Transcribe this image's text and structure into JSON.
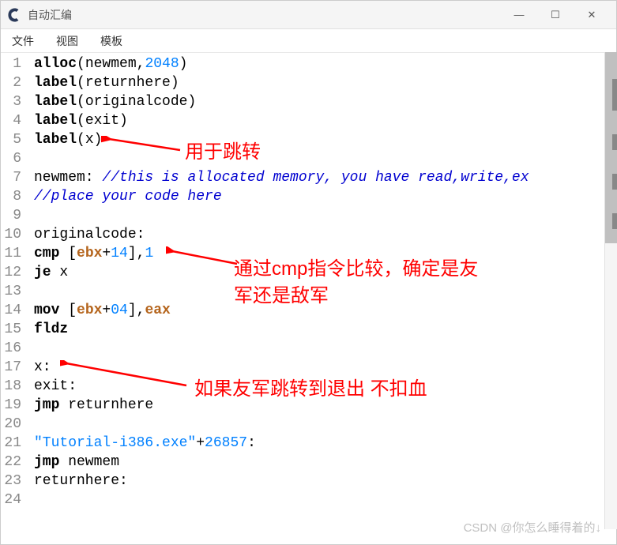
{
  "titlebar": {
    "title": "自动汇编"
  },
  "menu": {
    "file": "文件",
    "view": "视图",
    "template": "模板"
  },
  "code": {
    "lines": [
      {
        "n": "1",
        "m": false,
        "html": "<span class='kw'>alloc</span>(newmem,<span class='num'>2048</span>)"
      },
      {
        "n": "2",
        "m": false,
        "html": "<span class='kw'>label</span>(returnhere)"
      },
      {
        "n": "3",
        "m": false,
        "html": "<span class='kw'>label</span>(originalcode)"
      },
      {
        "n": "4",
        "m": true,
        "html": "<span class='kw'>label</span>(exit)"
      },
      {
        "n": "5",
        "m": true,
        "html": "<span class='kw'>label</span>(x)"
      },
      {
        "n": "6",
        "m": false,
        "html": ""
      },
      {
        "n": "7",
        "m": false,
        "html": "newmem: <span class='comment'>//this is allocated memory, you have read,write,ex</span>"
      },
      {
        "n": "8",
        "m": false,
        "html": "<span class='comment'>//place your code here</span>"
      },
      {
        "n": "9",
        "m": false,
        "html": ""
      },
      {
        "n": "10",
        "m": false,
        "html": "originalcode:"
      },
      {
        "n": "11",
        "m": true,
        "html": "<span class='kw'>cmp</span> [<span class='reg'>ebx</span>+<span class='num'>14</span>],<span class='num'>1</span>"
      },
      {
        "n": "12",
        "m": true,
        "html": "<span class='kw'>je</span> x"
      },
      {
        "n": "13",
        "m": false,
        "html": ""
      },
      {
        "n": "14",
        "m": false,
        "html": "<span class='kw'>mov</span> [<span class='reg'>ebx</span>+<span class='num'>04</span>],<span class='reg'>eax</span>"
      },
      {
        "n": "15",
        "m": true,
        "html": "<span class='kw'>fldz</span>"
      },
      {
        "n": "16",
        "m": true,
        "html": ""
      },
      {
        "n": "17",
        "m": true,
        "html": "x:"
      },
      {
        "n": "18",
        "m": false,
        "html": "exit:"
      },
      {
        "n": "19",
        "m": false,
        "html": "<span class='kw'>jmp</span> returnhere"
      },
      {
        "n": "20",
        "m": false,
        "html": ""
      },
      {
        "n": "21",
        "m": false,
        "html": "<span class='str'>\"Tutorial-i386.exe\"</span>+<span class='num'>26857</span>:"
      },
      {
        "n": "22",
        "m": false,
        "html": "<span class='kw'>jmp</span> newmem"
      },
      {
        "n": "23",
        "m": false,
        "html": "returnhere:"
      },
      {
        "n": "24",
        "m": false,
        "html": ""
      }
    ]
  },
  "annotations": {
    "a1": "用于跳转",
    "a2_line1": "通过cmp指令比较，确定是友",
    "a2_line2": "军还是敌军",
    "a3": "如果友军跳转到退出 不扣血"
  },
  "watermark": "CSDN @你怎么睡得着的↓",
  "win_controls": {
    "minimize": "—",
    "maximize": "☐",
    "close": "✕"
  }
}
